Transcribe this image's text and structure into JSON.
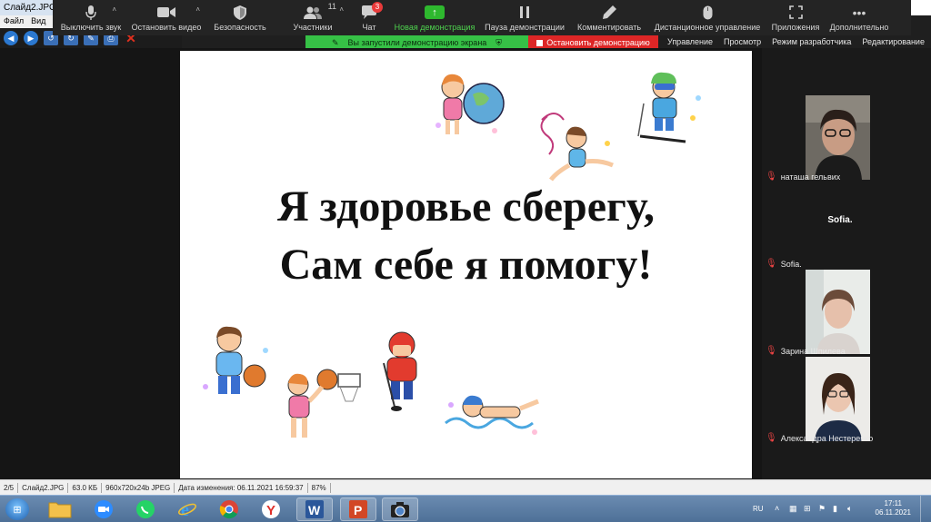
{
  "viewer": {
    "title": "Слайд2.JPG",
    "menu": [
      "Файл",
      "Вид"
    ],
    "right_menu": [
      "Управление",
      "Просмотр",
      "Режим разработчика",
      "Редактирование"
    ]
  },
  "toolbar": {
    "mute": "Выключить звук",
    "stop_video": "Остановить видео",
    "security": "Безопасность",
    "participants": "Участники",
    "participants_count": "11",
    "chat": "Чат",
    "chat_badge": "3",
    "new_share": "Новая демонстрация",
    "pause_share": "Пауза демонстрации",
    "annotate": "Комментировать",
    "remote_control": "Дистанционное управление",
    "apps": "Приложения",
    "more": "Дополнительно"
  },
  "share_banner": {
    "status": "Вы запустили демонстрацию экрана",
    "stop": "Остановить демонстрацию"
  },
  "slide": {
    "line1": "Я здоровье сберегу,",
    "line2": "Сам себе я помогу!"
  },
  "participants": [
    {
      "name": "наташа гельвих"
    },
    {
      "name": "Sofia.",
      "display": "Sofia."
    },
    {
      "name": "Зарина Шпилева"
    },
    {
      "name": "Александра Нестеренко"
    }
  ],
  "status_bar": {
    "page": "2/5",
    "file": "Слайд2.JPG",
    "size": "63.0 КБ",
    "dims": "960x720x24b JPEG",
    "modified": "Дата изменения: 06.11.2021 16:59:37",
    "zoom": "87%"
  },
  "taskbar": {
    "lang": "RU",
    "time": "17:11",
    "date": "06.11.2021"
  },
  "colors": {
    "share_green": "#36c146",
    "share_red": "#dd2626",
    "toolbar_bg": "#242424"
  }
}
